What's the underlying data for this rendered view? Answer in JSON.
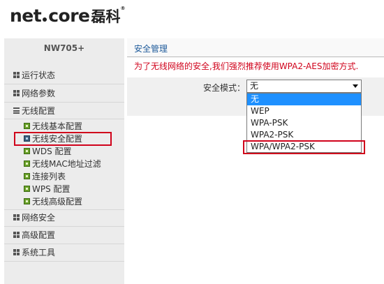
{
  "header": {
    "logo_main_1": "net",
    "logo_main_2": "core",
    "logo_cn": "磊科",
    "logo_reg": "®"
  },
  "sidebar": {
    "model": "NW705+",
    "items": [
      {
        "label": "运行状态",
        "icon": "grid-icon"
      },
      {
        "label": "网络参数",
        "icon": "grid-icon"
      },
      {
        "label": "无线配置",
        "icon": "menu-icon"
      },
      {
        "label": "网络安全",
        "icon": "grid-icon"
      },
      {
        "label": "高级配置",
        "icon": "grid-icon"
      },
      {
        "label": "系统工具",
        "icon": "grid-icon"
      }
    ],
    "wireless_sub": [
      {
        "label": "无线基本配置",
        "active": false
      },
      {
        "label": "无线安全配置",
        "active": true
      },
      {
        "label": "WDS 配置",
        "active": false
      },
      {
        "label": "无线MAC地址过滤",
        "active": false
      },
      {
        "label": "连接列表",
        "active": false
      },
      {
        "label": "WPS 配置",
        "active": false
      },
      {
        "label": "无线高级配置",
        "active": false
      }
    ]
  },
  "main": {
    "title": "安全管理",
    "tip": "为了无线网络的安全,我们强烈推荐使用WPA2-AES加密方式.",
    "security_mode_label": "安全模式：",
    "security_mode_value": "无",
    "options": [
      "无",
      "WEP",
      "WPA-PSK",
      "WPA2-PSK",
      "WPA/WPA2-PSK"
    ],
    "selected_option_index": 0
  },
  "colors": {
    "highlight_red": "#d0021b",
    "title_blue": "#1f5b9b",
    "option_selected_bg": "#1e90ff"
  }
}
